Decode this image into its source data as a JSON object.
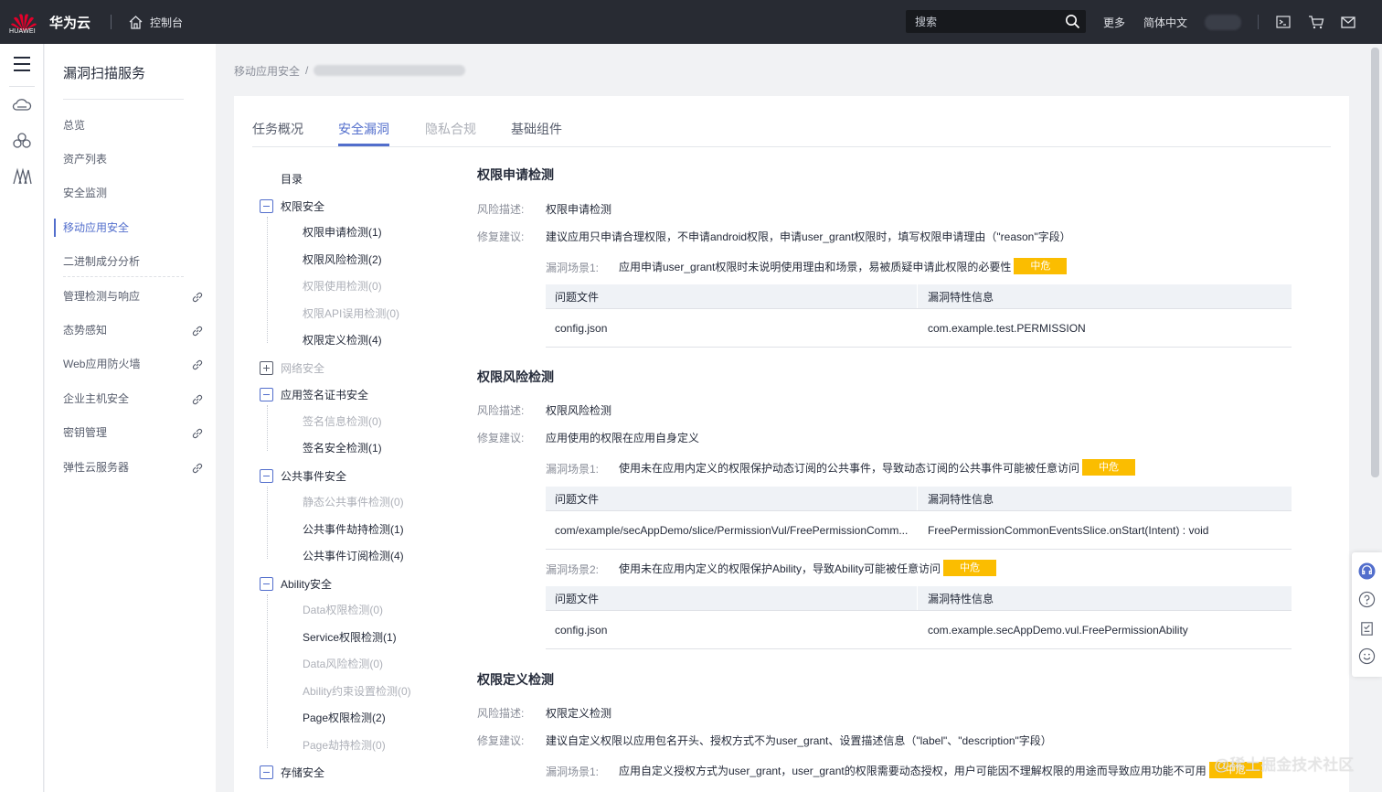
{
  "header": {
    "logo_text": "HUAWEI",
    "brand": "华为云",
    "console": "控制台",
    "search_placeholder": "搜索",
    "more": "更多",
    "language": "简体中文"
  },
  "sidebar": {
    "title": "漏洞扫描服务",
    "items": [
      {
        "label": "总览"
      },
      {
        "label": "资产列表"
      },
      {
        "label": "安全监测"
      },
      {
        "label": "移动应用安全"
      },
      {
        "label": "二进制成分分析"
      },
      {
        "label": "管理检测与响应"
      },
      {
        "label": "态势感知"
      },
      {
        "label": "Web应用防火墙"
      },
      {
        "label": "企业主机安全"
      },
      {
        "label": "密钥管理"
      },
      {
        "label": "弹性云服务器"
      }
    ]
  },
  "breadcrumb": {
    "root": "移动应用安全",
    "sep": "/"
  },
  "tabs": [
    {
      "label": "任务概况"
    },
    {
      "label": "安全漏洞"
    },
    {
      "label": "隐私合规"
    },
    {
      "label": "基础组件"
    }
  ],
  "tree": {
    "title": "目录",
    "groups": [
      {
        "label": "权限安全",
        "items": [
          "权限申请检测(1)",
          "权限风险检测(2)",
          "权限使用检测(0)",
          "权限API误用检测(0)",
          "权限定义检测(4)"
        ]
      },
      {
        "label": "网络安全",
        "items": []
      },
      {
        "label": "应用签名证书安全",
        "items": [
          "签名信息检测(0)",
          "签名安全检测(1)"
        ]
      },
      {
        "label": "公共事件安全",
        "items": [
          "静态公共事件检测(0)",
          "公共事件劫持检测(1)",
          "公共事件订阅检测(4)"
        ]
      },
      {
        "label": "Ability安全",
        "items": [
          "Data权限检测(0)",
          "Service权限检测(1)",
          "Data风险检测(0)",
          "Ability约束设置检测(0)",
          "Page权限检测(2)",
          "Page劫持检测(0)"
        ]
      },
      {
        "label": "存储安全",
        "items": []
      }
    ]
  },
  "detail": {
    "labels": {
      "risk": "风险描述:",
      "fix": "修复建议:",
      "file_col": "问题文件",
      "info_col": "漏洞特性信息"
    },
    "sections": [
      {
        "title": "权限申请检测",
        "risk": "权限申请检测",
        "fix": "建议应用只申请合理权限，不申请android权限，申请user_grant权限时，填写权限申请理由（\"reason\"字段）",
        "scenarios": [
          {
            "label": "漏洞场景1:",
            "text": "应用申请user_grant权限时未说明使用理由和场景，易被质疑申请此权限的必要性",
            "badge": "中危",
            "rows": [
              {
                "file": "config.json",
                "info": "com.example.test.PERMISSION"
              }
            ]
          }
        ]
      },
      {
        "title": "权限风险检测",
        "risk": "权限风险检测",
        "fix": "应用使用的权限在应用自身定义",
        "scenarios": [
          {
            "label": "漏洞场景1:",
            "text": "使用未在应用内定义的权限保护动态订阅的公共事件，导致动态订阅的公共事件可能被任意访问",
            "badge": "中危",
            "rows": [
              {
                "file": "com/example/secAppDemo/slice/PermissionVul/FreePermissionComm...",
                "info": "FreePermissionCommonEventsSlice.onStart(Intent) : void"
              }
            ]
          },
          {
            "label": "漏洞场景2:",
            "text": "使用未在应用内定义的权限保护Ability，导致Ability可能被任意访问",
            "badge": "中危",
            "rows": [
              {
                "file": "config.json",
                "info": "com.example.secAppDemo.vul.FreePermissionAbility"
              }
            ]
          }
        ]
      },
      {
        "title": "权限定义检测",
        "risk": "权限定义检测",
        "fix": "建议自定义权限以应用包名开头、授权方式不为user_grant、设置描述信息（\"label\"、\"description\"字段）",
        "scenarios": [
          {
            "label": "漏洞场景1:",
            "text": "应用自定义授权方式为user_grant，user_grant的权限需要动态授权，用户可能因不理解权限的用途而导致应用功能不可用",
            "badge": "中危",
            "rows": []
          }
        ]
      }
    ]
  },
  "watermark": "@稀土掘金技术社区",
  "colors": {
    "accent": "#526ecc",
    "topbar": "#282b33",
    "badge": "#fbbd00"
  }
}
